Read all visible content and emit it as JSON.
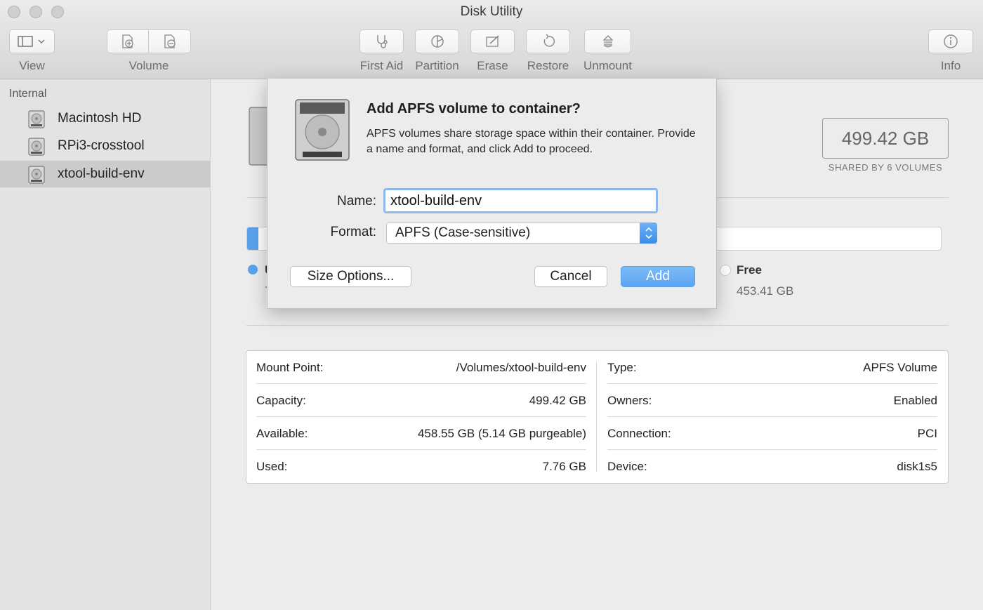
{
  "window": {
    "title": "Disk Utility"
  },
  "toolbar": {
    "view_label": "View",
    "volume_label": "Volume",
    "first_aid_label": "First Aid",
    "partition_label": "Partition",
    "erase_label": "Erase",
    "restore_label": "Restore",
    "unmount_label": "Unmount",
    "info_label": "Info"
  },
  "sidebar": {
    "section_header": "Internal",
    "items": [
      {
        "label": "Macintosh HD",
        "selected": false
      },
      {
        "label": "RPi3-crosstool",
        "selected": false
      },
      {
        "label": "xtool-build-env",
        "selected": true
      }
    ]
  },
  "main": {
    "capacity": "499.42 GB",
    "shared_by": "SHARED BY 6 VOLUMES",
    "used_fraction": 0.016,
    "free_label": "Free",
    "free_value": "453.41 GB",
    "used_fragment": "U",
    "used_value_fragment": "7",
    "colors": {
      "used": "#5aa2ec",
      "free": "#ffffff"
    },
    "info_left": [
      {
        "key": "Mount Point:",
        "value": "/Volumes/xtool-build-env"
      },
      {
        "key": "Capacity:",
        "value": "499.42 GB"
      },
      {
        "key": "Available:",
        "value": "458.55 GB (5.14 GB purgeable)"
      },
      {
        "key": "Used:",
        "value": "7.76 GB"
      }
    ],
    "info_right": [
      {
        "key": "Type:",
        "value": "APFS Volume"
      },
      {
        "key": "Owners:",
        "value": "Enabled"
      },
      {
        "key": "Connection:",
        "value": "PCI"
      },
      {
        "key": "Device:",
        "value": "disk1s5"
      }
    ]
  },
  "dialog": {
    "title": "Add APFS volume to container?",
    "description": "APFS volumes share storage space within their container. Provide a name and format, and click Add to proceed.",
    "name_label": "Name:",
    "name_value": "xtool-build-env",
    "format_label": "Format:",
    "format_value": "APFS (Case-sensitive)",
    "size_options_label": "Size Options...",
    "cancel_label": "Cancel",
    "add_label": "Add",
    "accent_color": "#5da5f1"
  }
}
